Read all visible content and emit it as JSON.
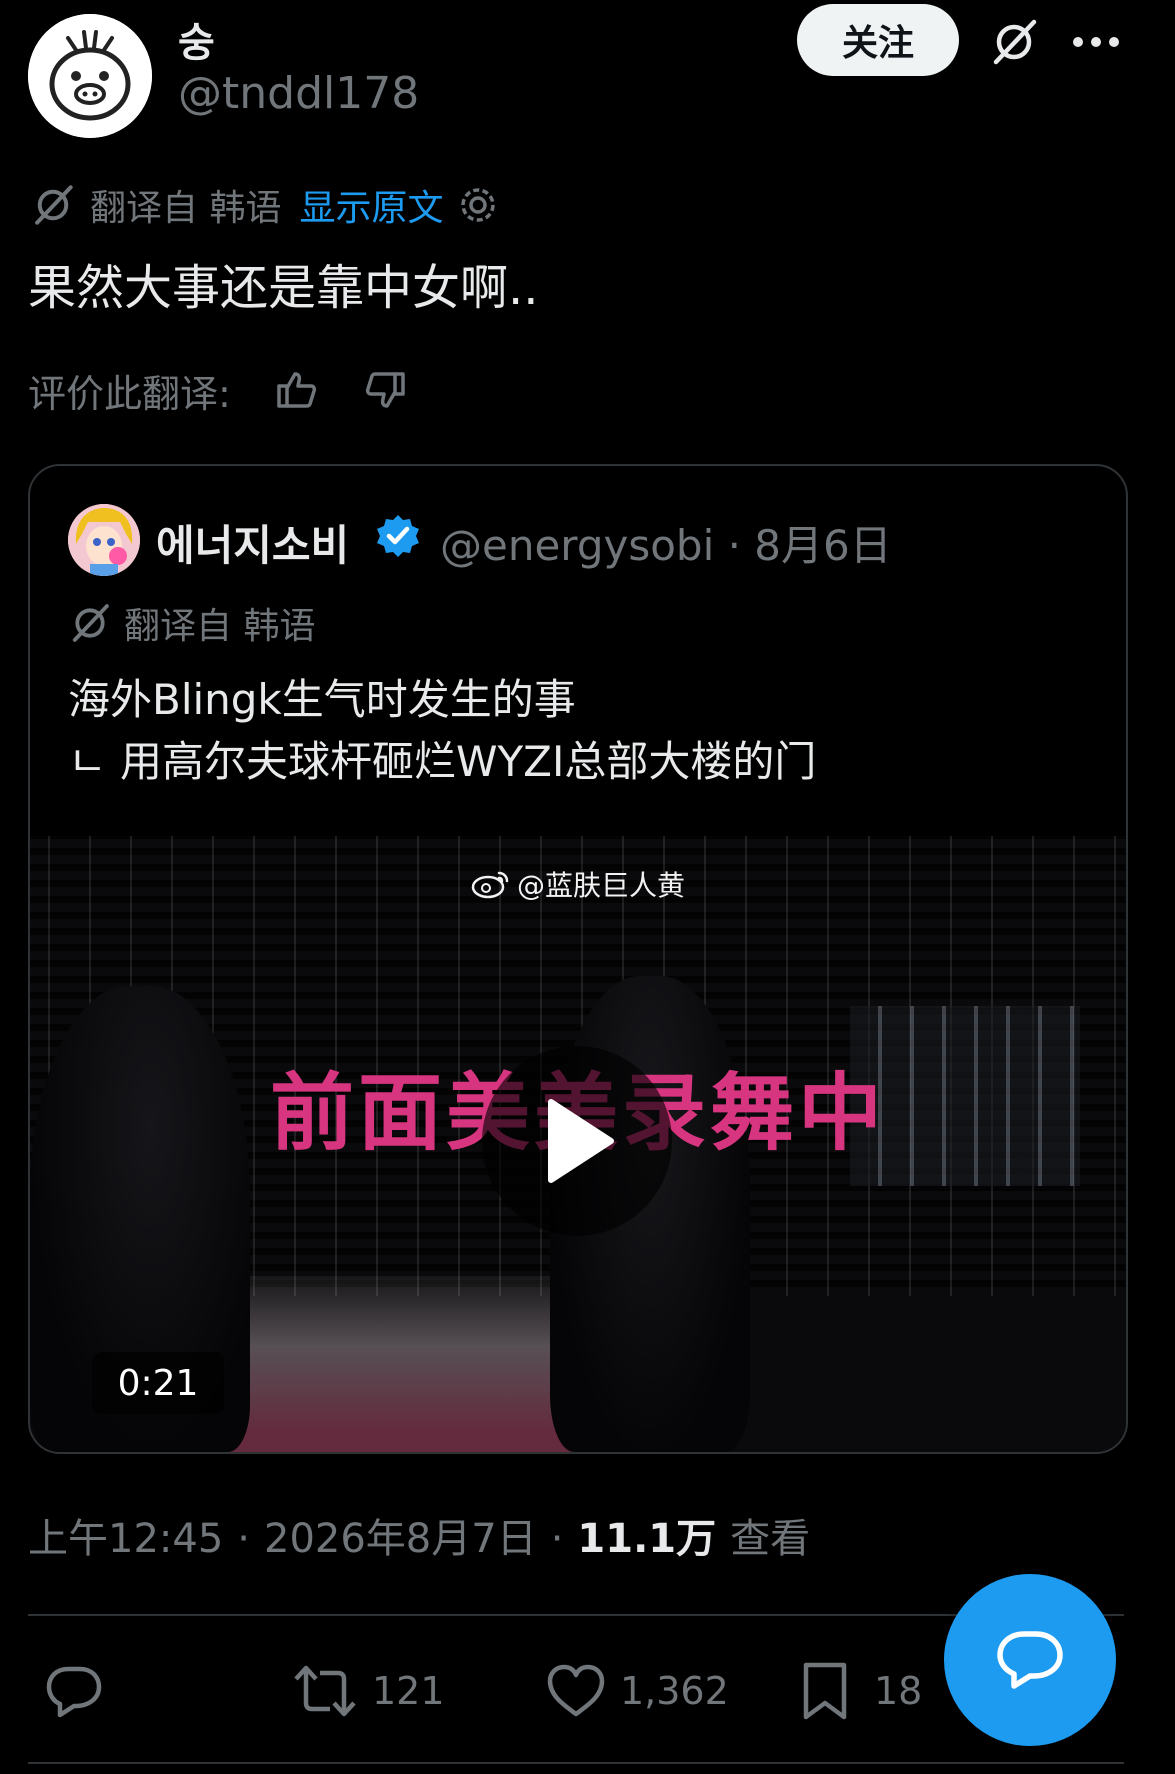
{
  "author": {
    "display_name": "숭",
    "handle": "@tnddl178",
    "avatar_icon": "cartoon-face-avatar"
  },
  "header": {
    "follow_label": "关注",
    "grok_icon": "grok-icon",
    "more_icon": "more-dots-icon"
  },
  "translation": {
    "label": "翻译自 韩语",
    "show_original": "显示原文"
  },
  "post": {
    "text": "果然大事还是靠中女啊.."
  },
  "rating": {
    "label": "评价此翻译:"
  },
  "quote": {
    "display_name": "에너지소비",
    "handle_date": "@energysobi · 8月6日",
    "translation_label": "翻译自 韩语",
    "line1": "海外Blingk生气时发生的事",
    "line2": "ㄴ 用高尔夫球杆砸烂WYZI总部大楼的门",
    "video": {
      "watermark": "@蓝肤巨人黄",
      "overlay_text": "前面美美录舞中",
      "duration": "0:21"
    }
  },
  "meta": {
    "time": "上午12:45",
    "date": "2026年8月7日",
    "views": "11.1万",
    "views_label": "查看"
  },
  "actions": {
    "retweets": "121",
    "likes": "1,362",
    "bookmarks": "18"
  },
  "colors": {
    "background": "#000000",
    "text": "#e7e9ea",
    "muted": "#71767b",
    "accent": "#1d9bf0",
    "overlay_pink": "#d7357f"
  }
}
